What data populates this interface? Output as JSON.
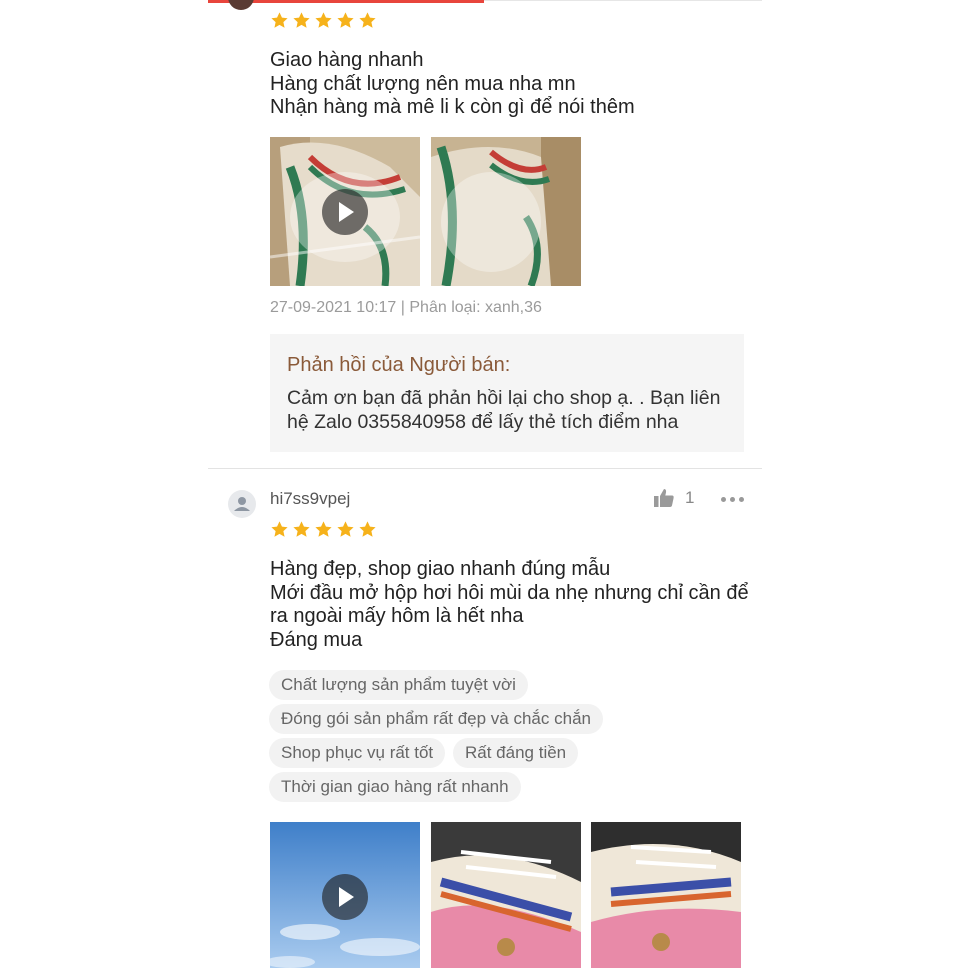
{
  "colors": {
    "accent": "#e8453c",
    "star": "#f6b21b",
    "reply_title": "#8a5a39",
    "muted_text": "#9b9b9b"
  },
  "icons": {
    "rating_star": "star-icon",
    "play": "play-icon",
    "like": "thumbs-up-icon",
    "more": "more-horizontal-icon",
    "user": "user-avatar-icon"
  },
  "review1": {
    "rating": 5,
    "lines": [
      "Giao hàng nhanh",
      "Hàng chất lượng nên mua nha mn",
      "Nhận hàng mà mê li k còn gì để nói thêm"
    ],
    "meta": "27-09-2021 10:17 | Phân loại: xanh,36",
    "seller_reply": {
      "title": "Phản hồi của Người bán:",
      "body": "Cảm ơn bạn đã phản hồi lại cho shop ạ.  . Bạn liên hệ Zalo 0355840958 để lấy thẻ tích điểm nha"
    }
  },
  "review2": {
    "username": "hi7ss9vpej",
    "likes": "1",
    "rating": 5,
    "lines": [
      "Hàng đẹp, shop giao nhanh đúng mẫu",
      "Mới đầu mở hộp hơi hôi mùi da nhẹ nhưng chỉ cần để",
      "ra ngoài mấy hôm là hết nha",
      "Đáng mua"
    ],
    "tags": [
      "Chất lượng sản phẩm tuyệt vời",
      "Đóng gói sản phẩm rất đẹp và chắc chắn",
      "Shop phục vụ rất tốt",
      "Rất đáng tiền",
      "Thời gian giao hàng rất nhanh"
    ]
  }
}
